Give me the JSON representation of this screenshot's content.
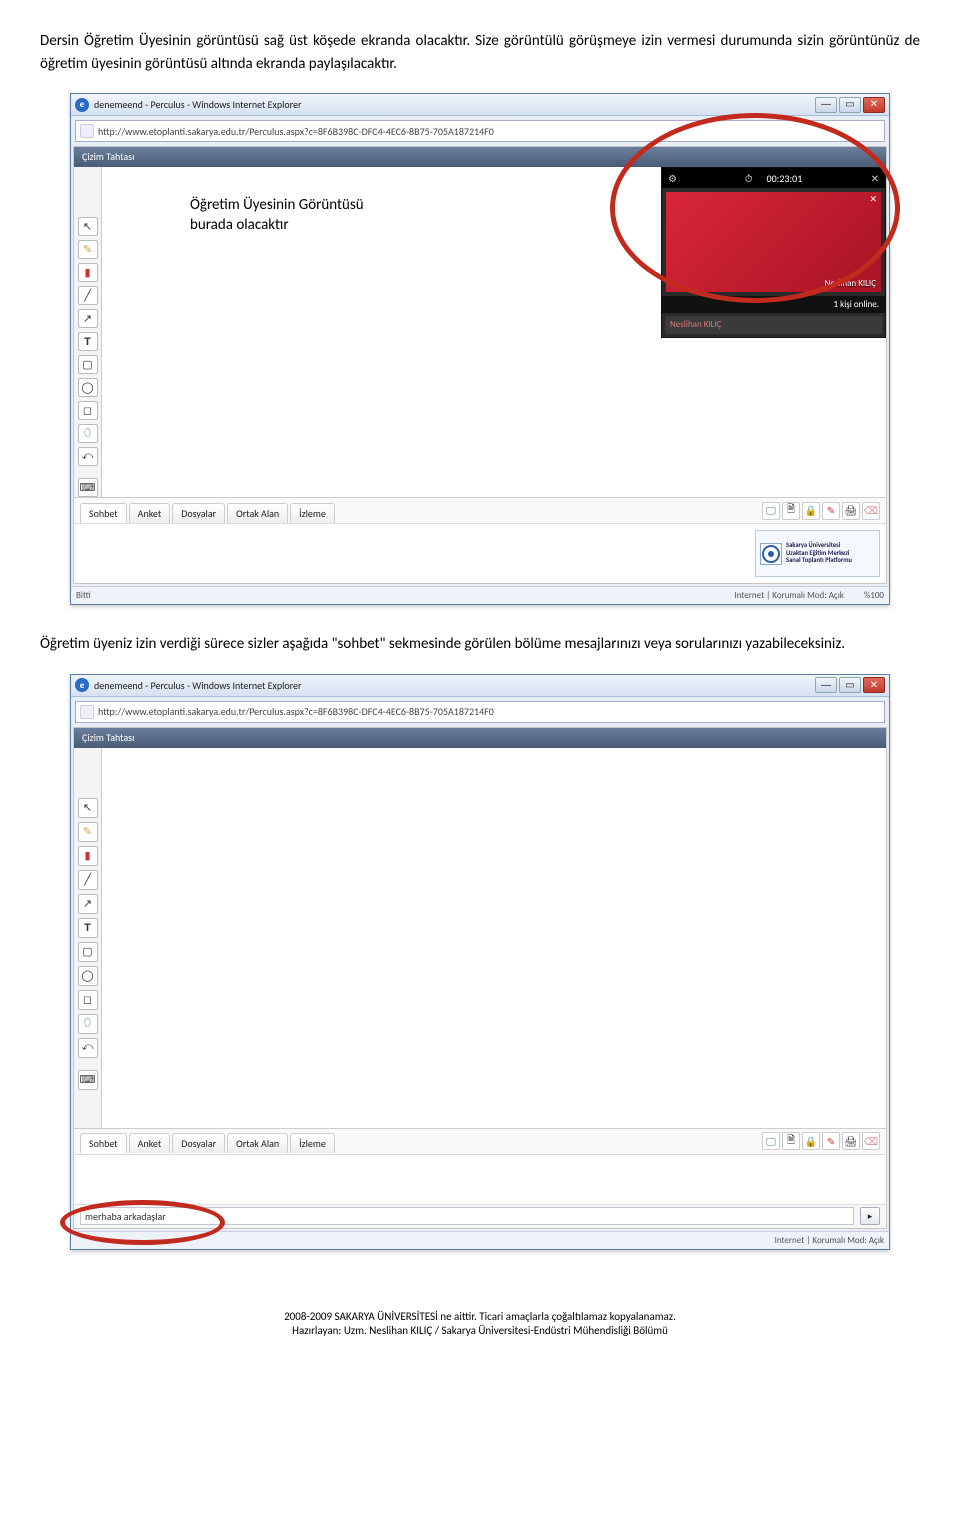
{
  "text": {
    "para1": "Dersin Öğretim Üyesinin görüntüsü sağ üst köşede ekranda olacaktır. Size görüntülü görüşmeye izin vermesi durumunda sizin görüntünüz de öğretim üyesinin görüntüsü altında ekranda paylaşılacaktır.",
    "para2": "Öğretim üyeniz izin verdiği sürece sizler aşağıda \"sohbet\" sekmesinde görülen bölüme mesajlarınızı veya sorularınızı yazabileceksiniz.",
    "annotation1_l1": "Öğretim Üyesinin Görüntüsü",
    "annotation1_l2": "burada olacaktır"
  },
  "browser": {
    "title": "denemeend - Perculus - Windows Internet Explorer",
    "url": "http://www.etoplanti.sakarya.edu.tr/Perculus.aspx?c=8F6B398C-DFC4-4EC6-8B75-705A187214F0",
    "tab_header": "Çizim Tahtası",
    "status_left": "Bitti",
    "status_right": "Internet | Korumalı Mod: Açık",
    "zoom": "%100"
  },
  "video": {
    "timer": "00:23:01",
    "presenter": "Neslihan KILIÇ",
    "online": "1 kişi online.",
    "list_name": "Neslihan KILIÇ"
  },
  "tabs": {
    "sohbet": "Sohbet",
    "anket": "Anket",
    "dosyalar": "Dosyalar",
    "ortak": "Ortak Alan",
    "izleme": "İzleme"
  },
  "logo": {
    "l1": "Sakarya Üniversitesi",
    "l2": "Uzaktan Eğitim Merkezi",
    "l3": "Sanal Toplantı Platformu"
  },
  "toolbar_icons": [
    "↖",
    "✎",
    "▮",
    "╱",
    "↗",
    "T",
    "▢",
    "◯",
    "◻",
    "⬯",
    "⤺",
    "⌨"
  ],
  "bottom_icons": [
    "🖵",
    "🗎",
    "🔒",
    "✎",
    "🖨",
    "⌫"
  ],
  "chat_value": "merhaba arkadaşlar",
  "footer": {
    "l1": "2008-2009 SAKARYA ÜNİVERSİTESİ ne aittir. Ticari amaçlarla çoğaltılamaz kopyalanamaz.",
    "l2": "Hazırlayan: Uzm. Neslihan KILIÇ / Sakarya Üniversitesi-Endüstri Mühendisliği Bölümü"
  }
}
